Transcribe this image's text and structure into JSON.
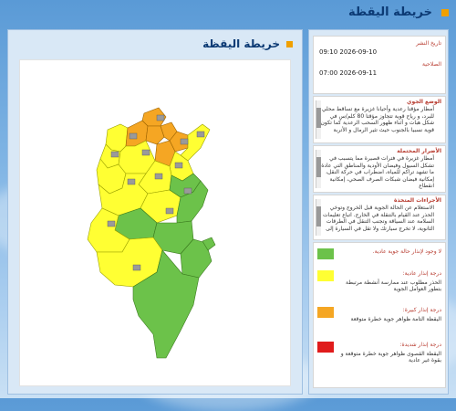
{
  "page": {
    "title": "خريطة اليقظة"
  },
  "map_panel": {
    "title": "خريطة اليقظة"
  },
  "info": {
    "issue_label": "تاريخ النشر",
    "issue_value": "09:10 2026-09-10",
    "validity_label": "الصلاحية",
    "validity_value": "07:00 2026-09-11",
    "weather_title": "الوضع الجوي",
    "weather_text": "أمطار مؤقتا رعدية وأحيانا غزيرة مع تساقط محلي للبرد، و رياح قوية تتجاوز مؤقتا 80 كلم/س في شكل هبات و أثناء ظهور السحب الرعدية كما تكون قوية نسبيا بالجنوب حيث تثير الرمال و الأتربة",
    "damage_title": "الأضرار المحتملة",
    "damage_text": "أمطار غزيرة في فترات قصيرة مما يتسبب في تشكل السيول وفيضان الأودية والمناطق التي عادة ما تشهد تراكم للمياه، اضطراب في حركة النقل، إمكانية فيضان شبكات الصرف الصحي، إمكانية انقطاع",
    "measures_title": "الأجراءات المتخذة",
    "measures_text": "الاستعلام عن الحالة الجوية قبل الخروج وتوخي الحذر عند القيام بالتنقلة في الخارج. اتباع تعليمات السلامة عند السياقة وتجنب التنقل في الطرقات الثانوية، لا تخرج سيارتك ولا تقل في السيارة إلى"
  },
  "legend": [
    {
      "label": "لا وجود لإنذار حالة جوية عادية.",
      "desc": "",
      "color": "#6cc24a"
    },
    {
      "label": "درجة إنذار عادية:",
      "desc": "الحذر مطلوب عند ممارسة أنشطة مرتبطة بتطور العوامل الجوية",
      "color": "#ffff33"
    },
    {
      "label": "درجة إنذار كبيرة:",
      "desc": "اليقظة التامة ظواهر جوية خطرة متوقعة",
      "color": "#f5a623"
    },
    {
      "label": "درجة إنذار شديدة:",
      "desc": "اليقظة القصوى ظواهر جوية خطرة متوقعة و بقوة غير عادية",
      "color": "#e01b1b"
    }
  ],
  "colors": {
    "green": "#6cc24a",
    "yellow": "#ffff33",
    "orange": "#f5a623",
    "red": "#e01b1b",
    "accent": "#f0a000"
  },
  "map_icons": [
    "storm-icon"
  ]
}
